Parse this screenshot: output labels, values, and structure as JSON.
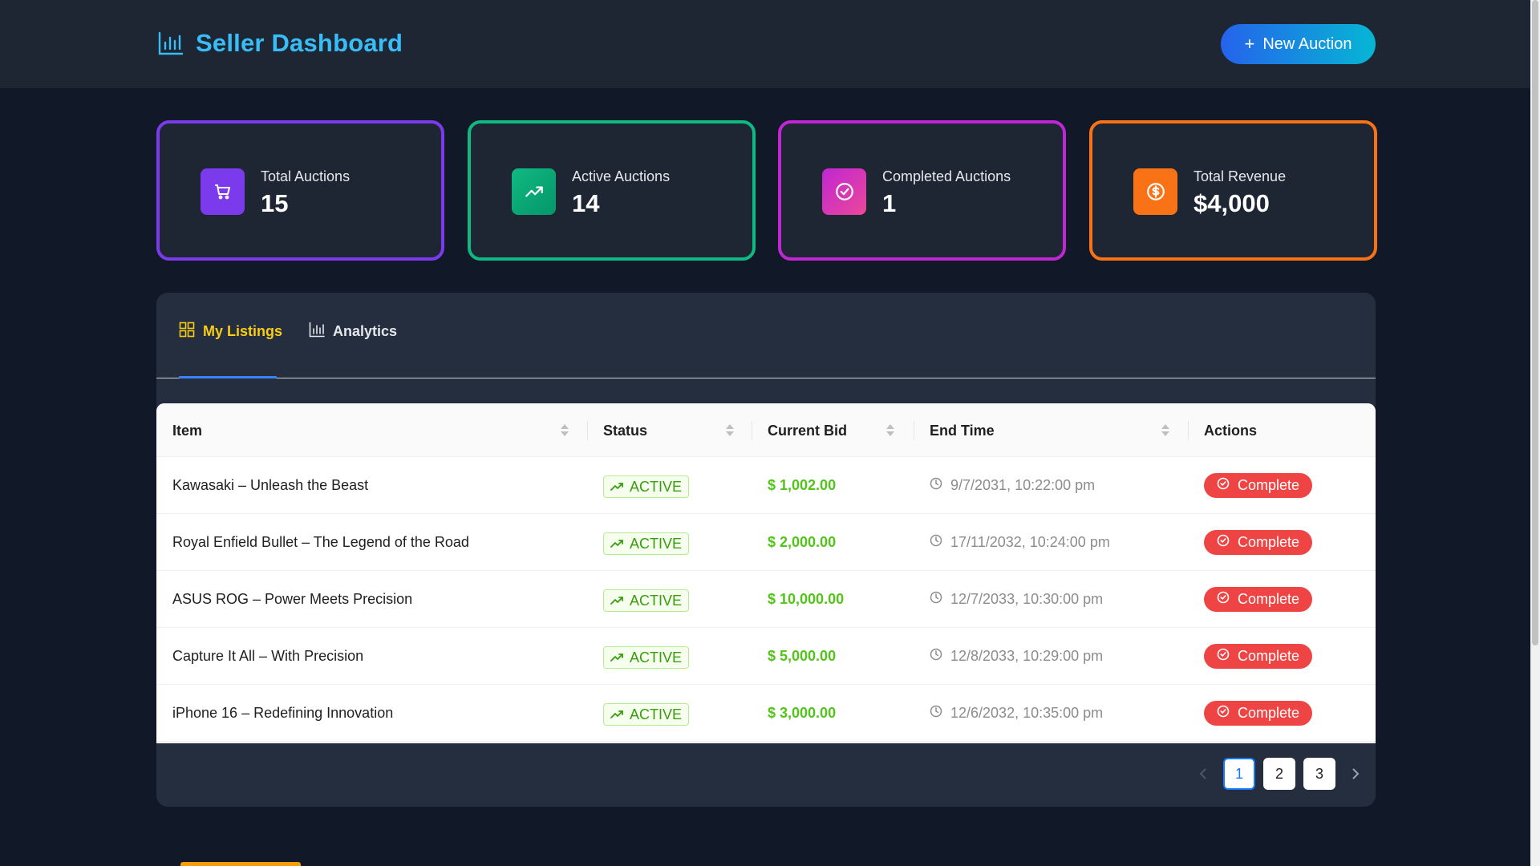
{
  "header": {
    "title": "Seller Dashboard",
    "new_auction_label": "New Auction"
  },
  "stats": [
    {
      "label": "Total Auctions",
      "value": "15",
      "icon": "cart-icon",
      "color": "#7c3aed"
    },
    {
      "label": "Active Auctions",
      "value": "14",
      "icon": "trending-up-icon",
      "color": "#10b981"
    },
    {
      "label": "Completed Auctions",
      "value": "1",
      "icon": "check-circle-icon",
      "color": "#c026d3"
    },
    {
      "label": "Total Revenue",
      "value": "$4,000",
      "icon": "dollar-icon",
      "color": "#f97316"
    }
  ],
  "tabs": [
    {
      "label": "My Listings",
      "icon": "grid-icon",
      "active": true
    },
    {
      "label": "Analytics",
      "icon": "bar-chart-icon",
      "active": false
    }
  ],
  "table": {
    "columns": [
      "Item",
      "Status",
      "Current Bid",
      "End Time",
      "Actions"
    ],
    "rows": [
      {
        "item": "Kawasaki – Unleash the Beast",
        "status": "ACTIVE",
        "bid": "$ 1,002.00",
        "end": "9/7/2031, 10:22:00 pm",
        "action": "Complete"
      },
      {
        "item": "Royal Enfield Bullet – The Legend of the Road",
        "status": "ACTIVE",
        "bid": "$ 2,000.00",
        "end": "17/11/2032, 10:24:00 pm",
        "action": "Complete"
      },
      {
        "item": "ASUS ROG – Power Meets Precision",
        "status": "ACTIVE",
        "bid": "$ 10,000.00",
        "end": "12/7/2033, 10:30:00 pm",
        "action": "Complete"
      },
      {
        "item": "Capture It All – With Precision",
        "status": "ACTIVE",
        "bid": "$ 5,000.00",
        "end": "12/8/2033, 10:29:00 pm",
        "action": "Complete"
      },
      {
        "item": "iPhone 16 – Redefining Innovation",
        "status": "ACTIVE",
        "bid": "$ 3,000.00",
        "end": "12/6/2032, 10:35:00 pm",
        "action": "Complete"
      }
    ]
  },
  "pagination": {
    "pages": [
      "1",
      "2",
      "3"
    ],
    "current": "1"
  },
  "colors": {
    "accent": "#38bdf8",
    "active_tab": "#facc15",
    "status_green": "#52c41a",
    "complete_red": "#ef4444"
  }
}
